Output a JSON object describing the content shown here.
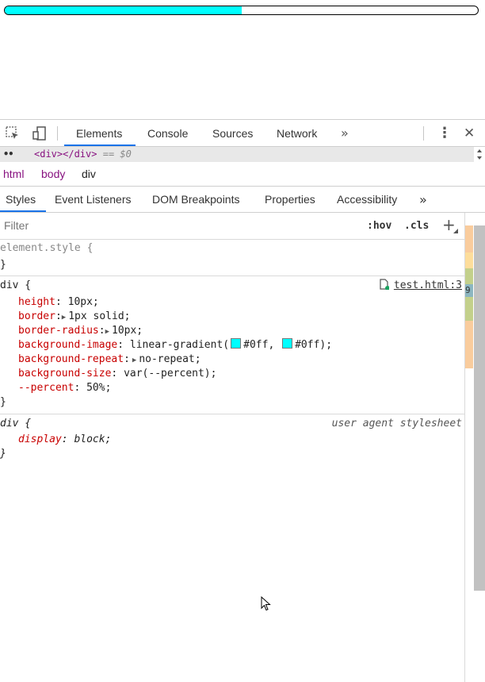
{
  "page": {
    "progress_percent": 50,
    "progress_color": "#00ffff"
  },
  "toolbar": {
    "tabs": [
      "Elements",
      "Console",
      "Sources",
      "Network"
    ],
    "active_tab": "Elements",
    "more_label": "»",
    "menu_label": "⋮",
    "close_label": "✕"
  },
  "selected_node": {
    "dots": "••",
    "code": "<div></div>",
    "suffix": "== $0"
  },
  "breadcrumb": [
    "html",
    "body",
    "div"
  ],
  "subtabs": {
    "items": [
      "Styles",
      "Event Listeners",
      "DOM Breakpoints",
      "Properties",
      "Accessibility"
    ],
    "active": "Styles",
    "more_label": "»"
  },
  "filter": {
    "placeholder": "Filter",
    "hov_label": ":hov",
    "cls_label": ".cls",
    "add_label": "+"
  },
  "rules": {
    "element_style": {
      "selector": "element.style {",
      "close": "}"
    },
    "div_rule": {
      "selector": "div {",
      "source": "test.html:3",
      "close": "}",
      "declarations": [
        {
          "prop": "height",
          "val": "10px;"
        },
        {
          "prop": "border",
          "val": "1px solid;"
        },
        {
          "prop": "border-radius",
          "val": "10px;"
        },
        {
          "prop": "background-image",
          "val_pre": "linear-gradient(",
          "color1": "#0ff",
          "sep": ", ",
          "color2": "#0ff",
          "val_post": ");"
        },
        {
          "prop": "background-repeat",
          "val": "no-repeat;"
        },
        {
          "prop": "background-size",
          "val": "var(--percent);"
        },
        {
          "prop": "--percent",
          "val": "50%;"
        }
      ]
    },
    "ua_rule": {
      "selector": "div {",
      "source": "user agent stylesheet",
      "prop": "display",
      "val": "block;",
      "close": "}"
    }
  },
  "side_strip_label": "9"
}
